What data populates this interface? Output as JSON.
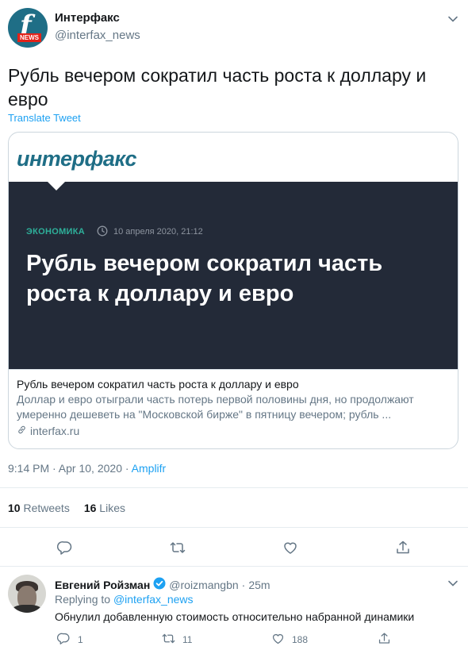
{
  "tweet": {
    "author_name": "Интерфакс",
    "author_handle": "@interfax_news",
    "avatar_letter": "f",
    "avatar_badge": "NEWS",
    "text": "Рубль вечером сократил часть роста к доллару и евро",
    "translate_label": "Translate Tweet",
    "time": "9:14 PM · Apr 10, 2020 · ",
    "source": "Amplifr",
    "retweets_count": "10",
    "retweets_label": " Retweets",
    "likes_count": "16",
    "likes_label": " Likes"
  },
  "card": {
    "logo_text": "интерфакс",
    "category": "ЭКОНОМИКА",
    "date": "10 апреля 2020, 21:12",
    "hero_title": "Рубль вечером сократил часть роста к доллару и евро",
    "title": "Рубль вечером сократил часть роста к доллару и евро",
    "description": "Доллар и евро отыграли часть потерь первой половины дня, но продолжают умеренно дешеветь на \"Московской бирже\" в пятницу вечером; рубль ...",
    "domain": "interfax.ru"
  },
  "reply": {
    "author_name": "Евгений Ройзман",
    "author_handle": "@roizmangbn",
    "time": "25m",
    "dot": "·",
    "replying_prefix": "Replying to ",
    "replying_to": "@interfax_news",
    "text": "Обнулил добавленную стоимость относительно набранной динамики",
    "reply_count": "1",
    "retweet_count": "11",
    "like_count": "188"
  },
  "colors": {
    "accent": "#1da1f2",
    "secondary_text": "#657786",
    "hero_bg": "#232a38",
    "category": "#2eb09a",
    "brand": "#1f6e86"
  },
  "icons": [
    "chevron-down-icon",
    "clock-icon",
    "link-icon",
    "reply-icon",
    "retweet-icon",
    "like-icon",
    "share-icon",
    "verified-icon"
  ]
}
